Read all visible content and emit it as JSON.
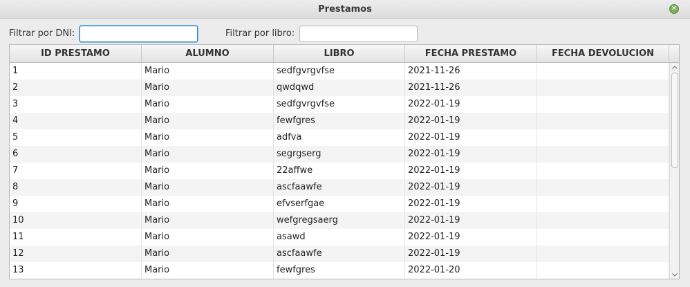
{
  "window": {
    "title": "Prestamos",
    "close_icon": "close-icon",
    "close_glyph": "✕"
  },
  "filters": {
    "dni_label": "Filtrar por DNI:",
    "dni_value": "",
    "libro_label": "Filtrar por libro:",
    "libro_value": ""
  },
  "table": {
    "columns": [
      "ID PRESTAMO",
      "ALUMNO",
      "LIBRO",
      "FECHA PRESTAMO",
      "FECHA DEVOLUCION"
    ],
    "rows": [
      [
        "1",
        "Mario",
        "sedfgvrgvfse",
        "2021-11-26",
        ""
      ],
      [
        "2",
        "Mario",
        "qwdqwd",
        "2021-11-26",
        ""
      ],
      [
        "3",
        "Mario",
        "sedfgvrgvfse",
        "2022-01-19",
        ""
      ],
      [
        "4",
        "Mario",
        "fewfgres",
        "2022-01-19",
        ""
      ],
      [
        "5",
        "Mario",
        "adfva",
        "2022-01-19",
        ""
      ],
      [
        "6",
        "Mario",
        "segrgserg",
        "2022-01-19",
        ""
      ],
      [
        "7",
        "Mario",
        "22affwe",
        "2022-01-19",
        ""
      ],
      [
        "8",
        "Mario",
        "ascfaawfe",
        "2022-01-19",
        ""
      ],
      [
        "9",
        "Mario",
        "efvserfgae",
        "2022-01-19",
        ""
      ],
      [
        "10",
        "Mario",
        "wefgregsaerg",
        "2022-01-19",
        ""
      ],
      [
        "11",
        "Mario",
        "asawd",
        "2022-01-19",
        ""
      ],
      [
        "12",
        "Mario",
        "ascfaawfe",
        "2022-01-19",
        ""
      ],
      [
        "13",
        "Mario",
        "fewfgres",
        "2022-01-20",
        ""
      ]
    ]
  },
  "colors": {
    "close_button": "#7ab05a",
    "focus_border": "#2d89c6",
    "row_alt": "#f4f4f4"
  }
}
